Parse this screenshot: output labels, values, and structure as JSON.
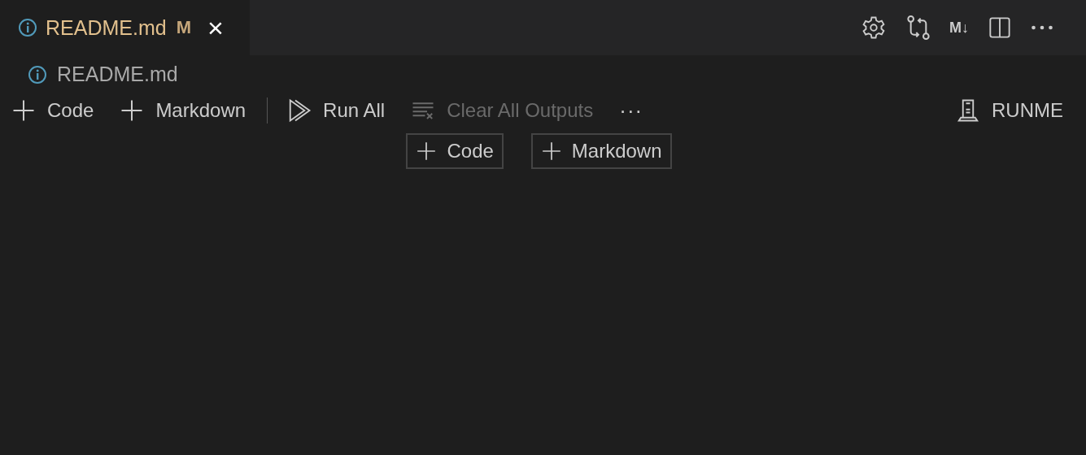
{
  "tabs": [
    {
      "label": "README.md",
      "status": "M",
      "selected": true,
      "close": "×"
    }
  ],
  "editor_actions": {
    "markdown_icon": "M↓"
  },
  "breadcrumb": {
    "label": "README.md"
  },
  "toolbar": {
    "items": [
      {
        "kind": "add",
        "label": "Code",
        "disabled": false
      },
      {
        "kind": "add",
        "label": "Markdown",
        "disabled": false
      },
      {
        "kind": "run",
        "label": "Run All",
        "disabled": false
      },
      {
        "kind": "clear",
        "label": "Clear All Outputs",
        "disabled": true
      }
    ],
    "more": "···",
    "runme": "RUNME"
  },
  "insert_buttons": [
    {
      "label": "Code"
    },
    {
      "label": "Markdown"
    }
  ]
}
